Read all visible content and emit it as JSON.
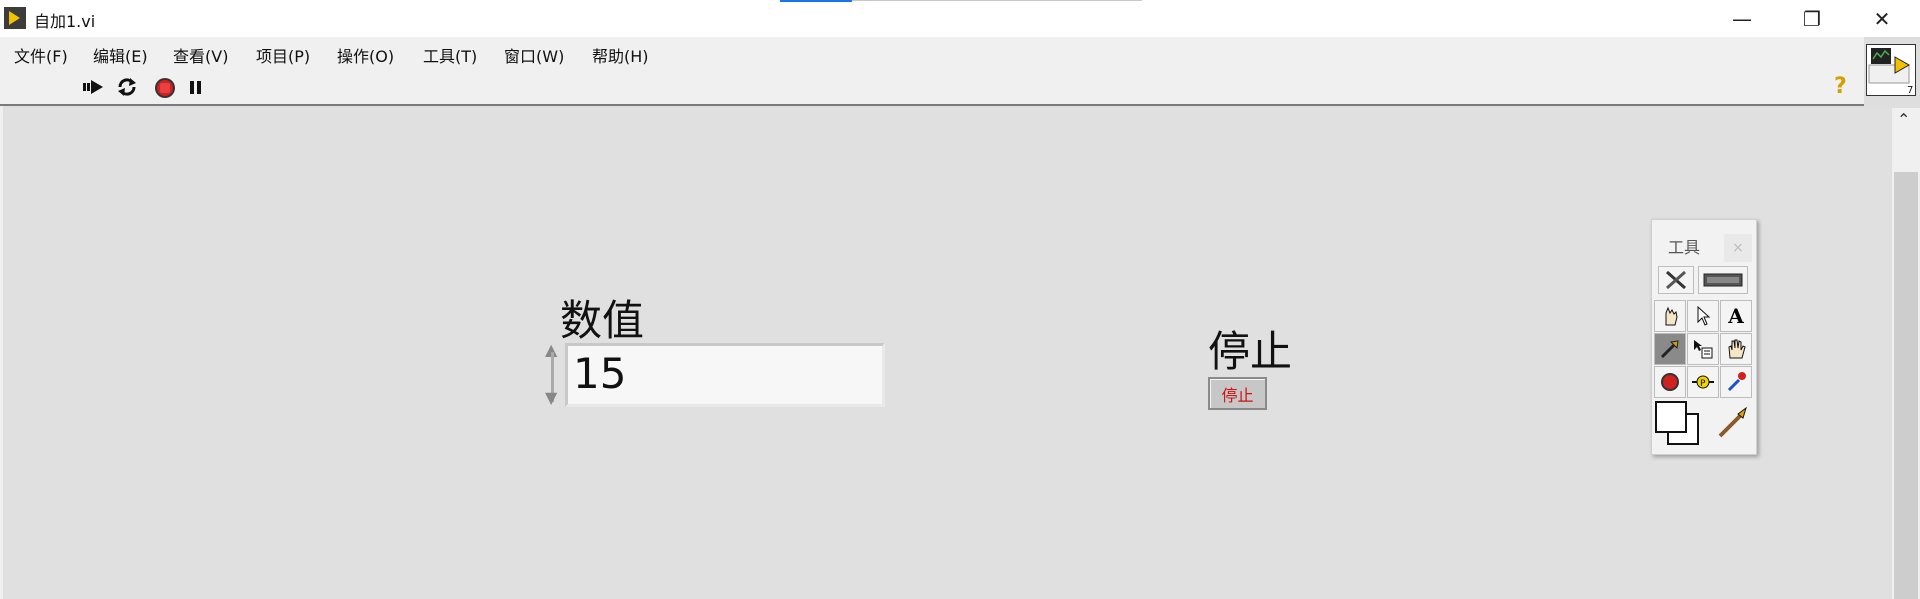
{
  "window": {
    "title": "自加1.vi",
    "controls": [
      "minimize-icon",
      "restore-icon",
      "close-icon"
    ]
  },
  "menu": [
    "文件(F)",
    "编辑(E)",
    "查看(V)",
    "项目(P)",
    "操作(O)",
    "工具(T)",
    "窗口(W)",
    "帮助(H)"
  ],
  "toolbar": {
    "icons": [
      "run-arrow-icon",
      "run-continuously-icon",
      "abort-icon",
      "pause-icon"
    ],
    "help_icon": "?"
  },
  "front_panel": {
    "numeric": {
      "label": "数值",
      "value": "15"
    },
    "stop": {
      "label": "停止",
      "button_text": "停止",
      "button_text_color": "#d01010"
    }
  },
  "tools_palette": {
    "title": "工具",
    "close": "×",
    "tools": [
      "automatic-tool-icon",
      "operate-icon",
      "position-icon",
      "text-icon",
      "wiring-icon",
      "shortcut-menu-icon",
      "scroll-icon",
      "breakpoint-icon",
      "probe-icon",
      "get-color-icon",
      "color-boxes-icon",
      "set-color-icon"
    ]
  },
  "colors": {
    "panel_bg": "#e0e0e0",
    "chrome_bg": "#f0f0f0",
    "accent": "#1a73e8"
  }
}
